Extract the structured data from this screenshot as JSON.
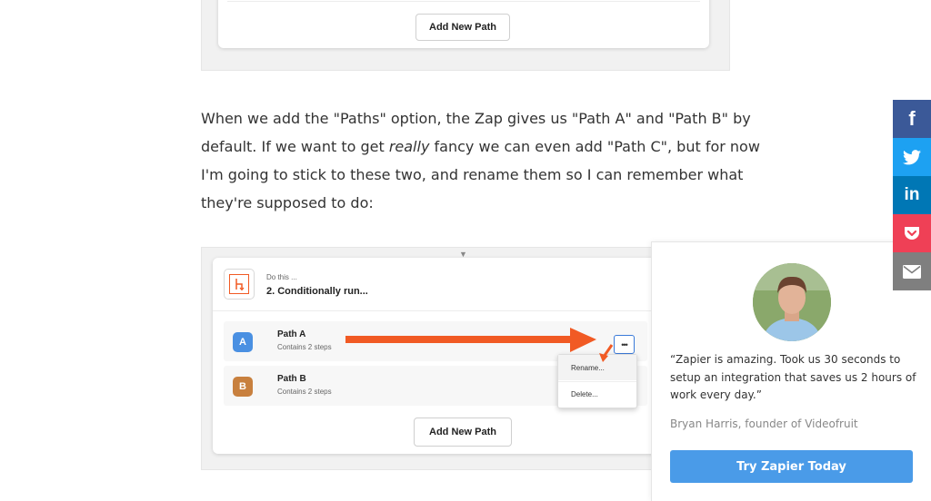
{
  "top_screenshot": {
    "add_button_label": "Add New Path"
  },
  "article": {
    "paragraph_lines": [
      "When we add the \"Paths\" option, the Zap gives us \"Path A\" and \"Path B\" by",
      "default. If we want to get ",
      "really",
      " fancy we can even add \"Path C\", but for now",
      "I'm going to stick to these two, and rename them so I can remember what",
      "they're supposed to do:"
    ]
  },
  "zap_editor": {
    "step": {
      "label": "Do this ...",
      "title": "2. Conditionally run..."
    },
    "paths": [
      {
        "badge": "A",
        "name": "Path A",
        "subtitle": "Contains 2 steps",
        "color": "#4a90e2"
      },
      {
        "badge": "B",
        "name": "Path B",
        "subtitle": "Contains 2 steps",
        "color": "#c8803e"
      }
    ],
    "more_button_label": "•••",
    "menu": {
      "rename": "Rename...",
      "delete": "Delete..."
    },
    "add_button_label": "Add New Path",
    "highlight_color": "#f15a24"
  },
  "testimonial": {
    "quote_lines": [
      "“Zapier is amazing. Took us 30 seconds to",
      "setup an integration that saves us 2 hours of",
      "work every day.”"
    ],
    "attribution": "Bryan Harris, founder of Videofruit",
    "cta_label": "Try Zapier Today"
  },
  "share_bar": [
    {
      "name": "facebook",
      "icon": "facebook-icon",
      "color": "#3b5998",
      "glyph": "f"
    },
    {
      "name": "twitter",
      "icon": "twitter-icon",
      "color": "#1da1f2",
      "glyph": ""
    },
    {
      "name": "linkedin",
      "icon": "linkedin-icon",
      "color": "#0077b5",
      "glyph": "in"
    },
    {
      "name": "pocket",
      "icon": "pocket-icon",
      "color": "#ef4056",
      "glyph": ""
    },
    {
      "name": "email",
      "icon": "email-icon",
      "color": "#7f7f7f",
      "glyph": ""
    }
  ]
}
